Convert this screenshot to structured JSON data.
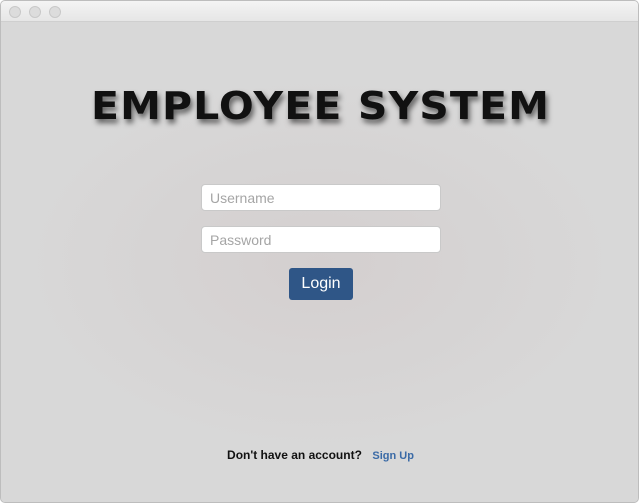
{
  "window": {
    "traffic_lights": [
      "close",
      "minimize",
      "maximize"
    ]
  },
  "app": {
    "title": "Employee System"
  },
  "login_form": {
    "username_placeholder": "Username",
    "password_placeholder": "Password",
    "username_value": "",
    "password_value": "",
    "login_label": "Login"
  },
  "footer": {
    "prompt": "Don't have an account?",
    "signup_label": "Sign Up"
  },
  "colors": {
    "accent": "#2f5687",
    "link": "#3a6aa6",
    "background": "#d8d8d8"
  }
}
